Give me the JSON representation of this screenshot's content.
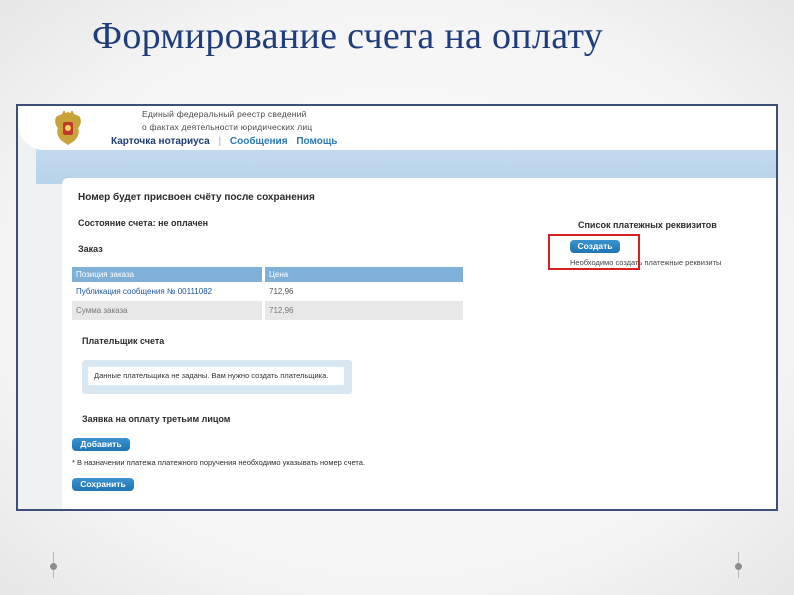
{
  "slide": {
    "title": "Формирование счета на оплату"
  },
  "header": {
    "site_name_line1": "Единый федеральный реестр сведений",
    "site_name_line2": "о фактах деятельности юридических лиц",
    "nav": {
      "current": "Карточка нотариуса",
      "separator": "|",
      "messages": "Сообщения",
      "help": "Помощь"
    }
  },
  "main": {
    "heading": "Номер будет присвоен счёту после сохранения",
    "status": "Состояние счета: не оплачен",
    "order_heading": "Заказ",
    "table": {
      "headers": [
        "Позиция заказа",
        "Цена"
      ],
      "rows": [
        [
          "Публикация сообщения № 00111082",
          "712,96"
        ],
        [
          "Сумма заказа",
          "712,96"
        ]
      ]
    },
    "payer_heading": "Плательщик счета",
    "payer_info": "Данные плательщика не заданы. Вам нужно создать плательщика.",
    "third_party_heading": "Заявка на оплату третьим лицом",
    "add_button": "Добавить",
    "note": "* В назначении платежа платежного поручения необходимо указывать номер счета.",
    "save_button": "Сохранить"
  },
  "requisites": {
    "heading": "Список платежных реквизитов",
    "create_button": "Создать",
    "note": "Необходимо создать платежные реквизиты"
  },
  "colors": {
    "title": "#1f3d7a",
    "button": "#2484c1",
    "highlight": "#d52020",
    "table_header": "#7fb0d8"
  }
}
